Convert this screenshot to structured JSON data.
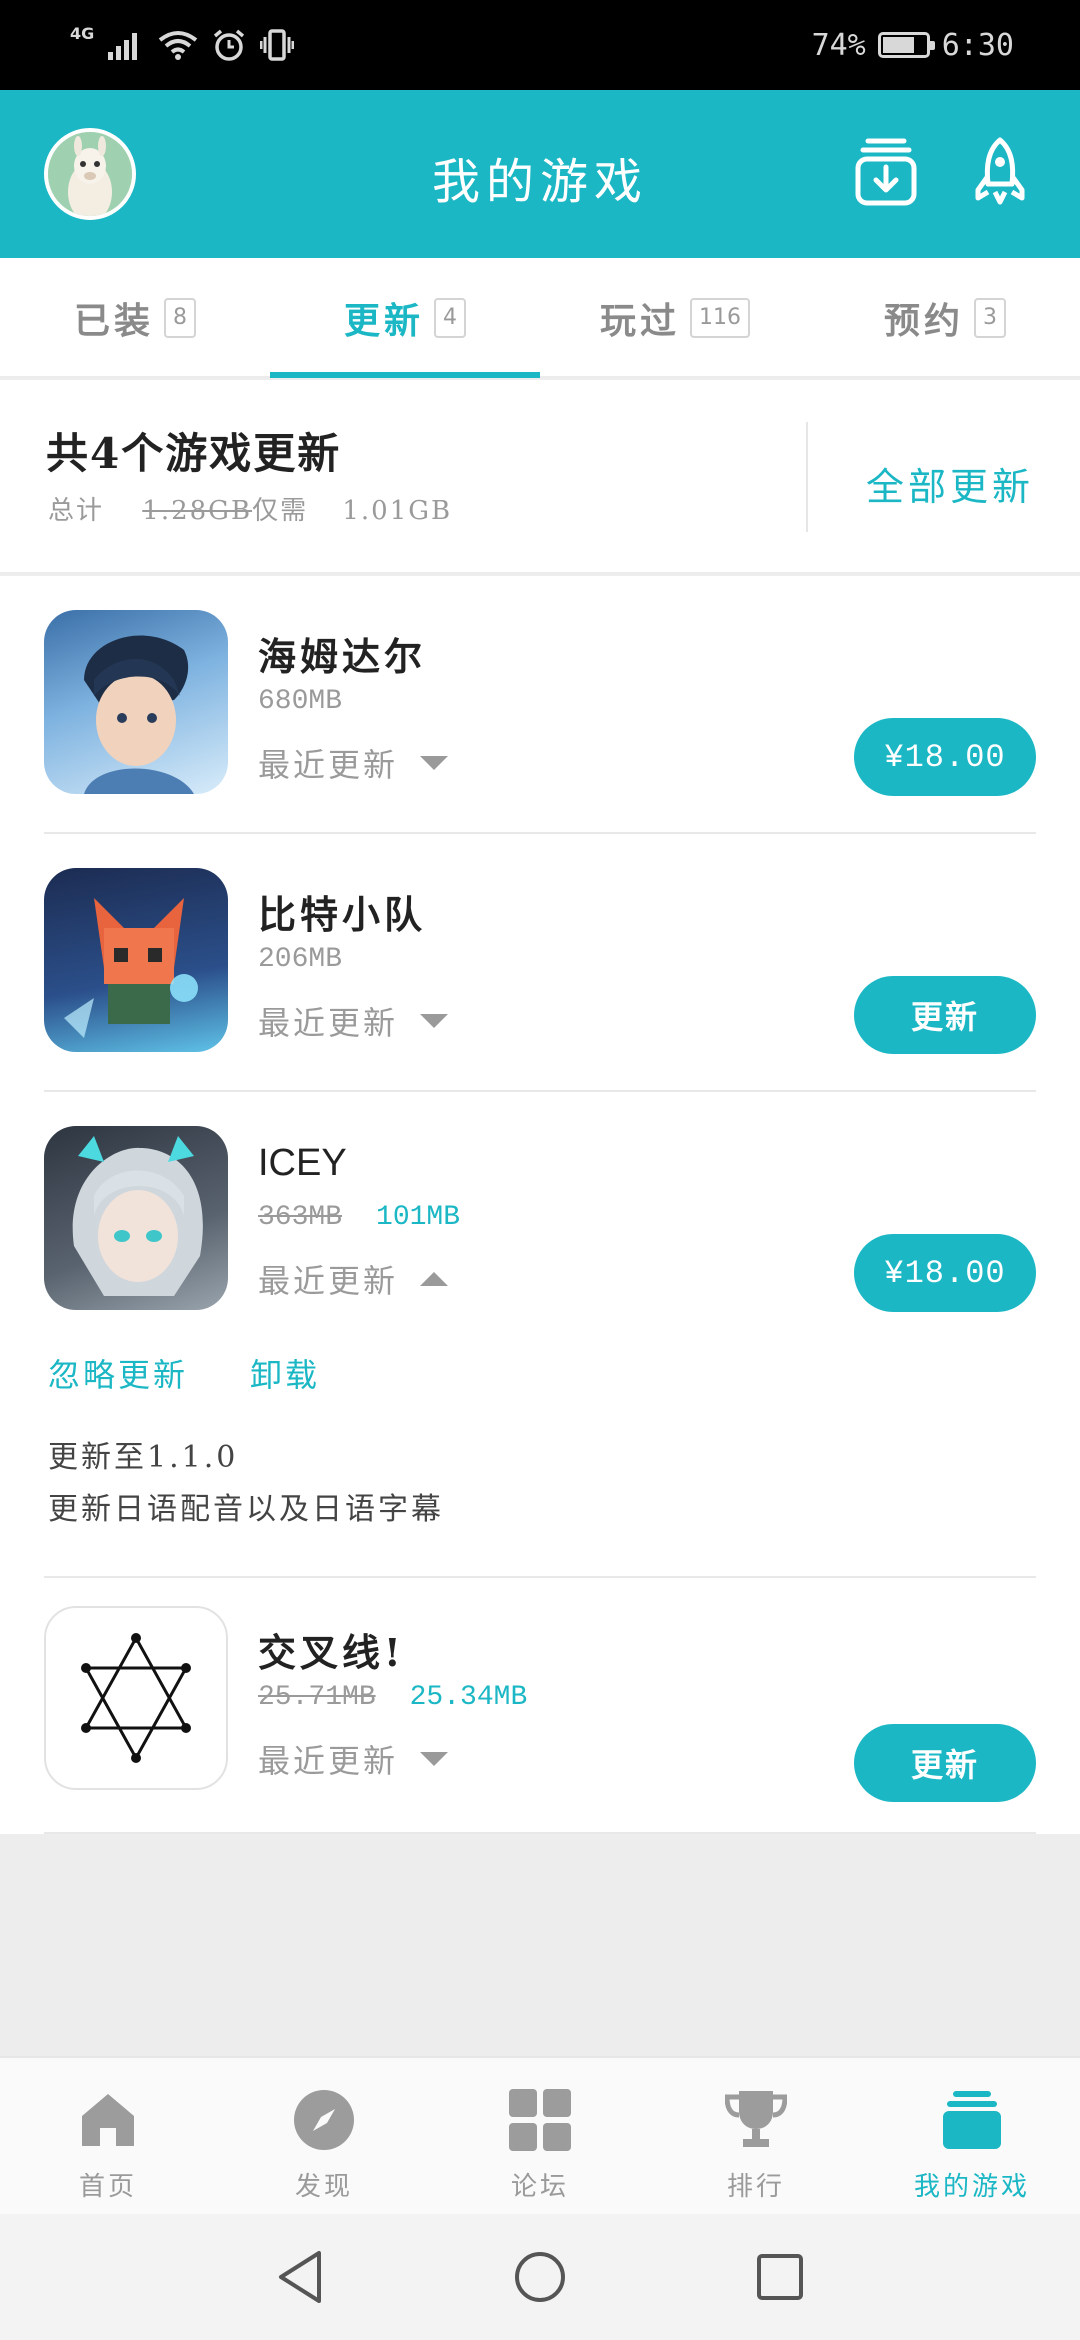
{
  "status_bar": {
    "network": "4G",
    "battery": "74%",
    "battery_level": 0.74,
    "time": "6:30"
  },
  "header": {
    "title": "我的游戏",
    "icons": [
      "avatar",
      "download-icon",
      "rocket-icon"
    ]
  },
  "tabs": [
    {
      "label": "已装",
      "count": "8",
      "active": false
    },
    {
      "label": "更新",
      "count": "4",
      "active": true
    },
    {
      "label": "玩过",
      "count": "116",
      "active": false
    },
    {
      "label": "预约",
      "count": "3",
      "active": false
    }
  ],
  "summary": {
    "title": "共4个游戏更新",
    "total_label": "总计",
    "total_old": "1.28GB",
    "only_need": "仅需",
    "total_new": "1.01GB",
    "update_all": "全部更新"
  },
  "games": [
    {
      "name": "海姆达尔",
      "size": "680MB",
      "recent": "最近更新",
      "button": "¥18.00",
      "expanded": false
    },
    {
      "name": "比特小队",
      "size": "206MB",
      "recent": "最近更新",
      "button": "更新",
      "expanded": false
    },
    {
      "name": "ICEY",
      "size_old": "363MB",
      "size_new": "101MB",
      "recent": "最近更新",
      "button": "¥18.00",
      "expanded": true,
      "actions": [
        "忽略更新",
        "卸载"
      ],
      "notes": [
        "更新至1.1.0",
        "更新日语配音以及日语字幕"
      ]
    },
    {
      "name": "交叉线!",
      "size_old": "25.71MB",
      "size_new": "25.34MB",
      "recent": "最近更新",
      "button": "更新",
      "expanded": false
    }
  ],
  "bottom_nav": [
    {
      "label": "首页",
      "icon": "home-icon",
      "active": false
    },
    {
      "label": "发现",
      "icon": "compass-icon",
      "active": false
    },
    {
      "label": "论坛",
      "icon": "grid-icon",
      "active": false
    },
    {
      "label": "排行",
      "icon": "trophy-icon",
      "active": false
    },
    {
      "label": "我的游戏",
      "icon": "stack-icon",
      "active": true
    }
  ],
  "colors": {
    "accent": "#1bb7c5",
    "gray_text": "#9a9a9a"
  }
}
